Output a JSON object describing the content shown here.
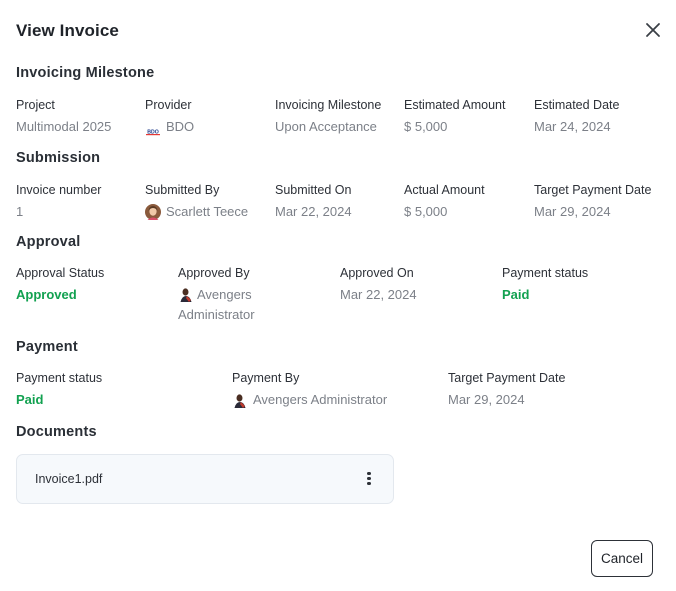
{
  "title": "View Invoice",
  "milestone_section": {
    "heading": "Invoicing Milestone",
    "fields": [
      {
        "label": "Project",
        "value": "Multimodal 2025"
      },
      {
        "label": "Provider",
        "value": "BDO",
        "logo_text": "BDO"
      },
      {
        "label": "Invoicing Milestone",
        "value": "Upon Acceptance"
      },
      {
        "label": "Estimated Amount",
        "value": "$ 5,000"
      },
      {
        "label": "Estimated Date",
        "value": "Mar 24, 2024"
      }
    ]
  },
  "submission_section": {
    "heading": "Submission",
    "fields": [
      {
        "label": "Invoice number",
        "value": "1"
      },
      {
        "label": "Submitted By",
        "value": "Scarlett Teece"
      },
      {
        "label": "Submitted On",
        "value": "Mar 22, 2024"
      },
      {
        "label": "Actual Amount",
        "value": "$ 5,000"
      },
      {
        "label": "Target Payment Date",
        "value": "Mar 29, 2024"
      }
    ]
  },
  "approval_section": {
    "heading": "Approval",
    "fields": [
      {
        "label": "Approval Status",
        "value": "Approved"
      },
      {
        "label": "Approved By",
        "value": "Avengers Administrator"
      },
      {
        "label": "Approved On",
        "value": "Mar 22, 2024"
      },
      {
        "label": "Payment status",
        "value": "Paid"
      }
    ]
  },
  "payment_section": {
    "heading": "Payment",
    "fields": [
      {
        "label": "Payment status",
        "value": "Paid"
      },
      {
        "label": "Payment By",
        "value": "Avengers Administrator"
      },
      {
        "label": "Target Payment Date",
        "value": "Mar 29, 2024"
      }
    ]
  },
  "documents_section": {
    "heading": "Documents",
    "files": [
      {
        "name": "Invoice1.pdf"
      }
    ]
  },
  "footer": {
    "cancel_label": "Cancel"
  },
  "colors": {
    "status_green": "#12a150",
    "muted_text": "#7c8088",
    "card_bg": "#f6f9fc"
  },
  "icons": [
    "close-icon",
    "bdo-logo",
    "more-vertical-icon"
  ]
}
